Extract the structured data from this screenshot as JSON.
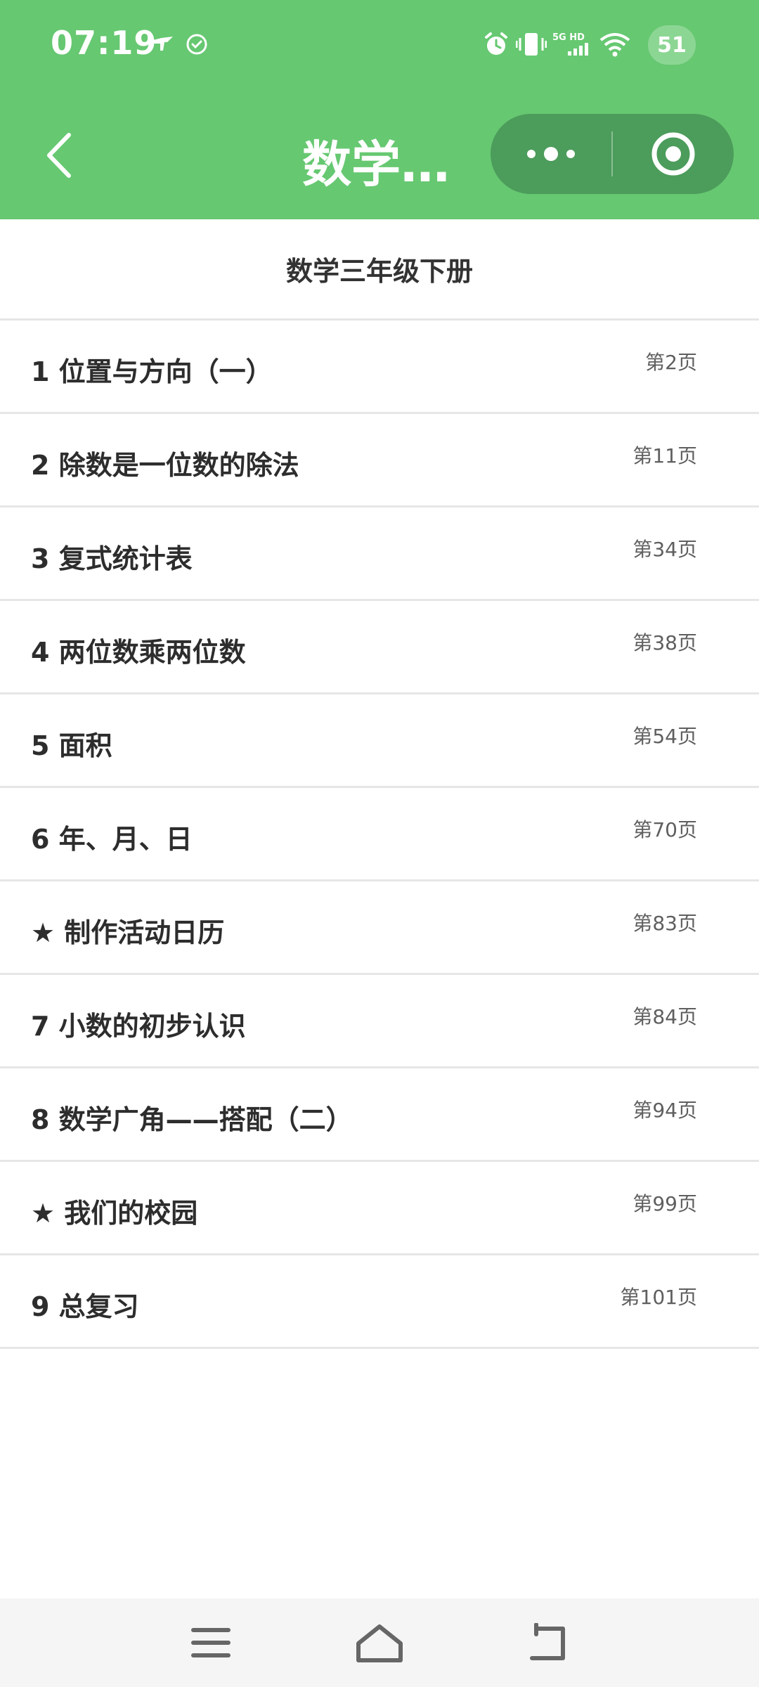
{
  "status_bar": {
    "time": "07:19",
    "network_label": "5G HD",
    "notification_badge": "51",
    "icons": [
      "bird-notification-icon",
      "check-circle-icon",
      "alarm-icon",
      "vibrate-icon",
      "signal-icon",
      "wifi-icon"
    ]
  },
  "navbar": {
    "title": "数学…",
    "back_icon": "chevron-left-icon",
    "more_icon": "more-dots-icon",
    "target_icon": "target-icon",
    "color": "#66c871",
    "capsule_color": "#4c9c5b"
  },
  "book": {
    "title": "数学三年级下册"
  },
  "chapters": [
    {
      "name": "1 位置与方向（一）",
      "page": "第2页"
    },
    {
      "name": "2 除数是一位数的除法",
      "page": "第11页"
    },
    {
      "name": "3 复式统计表",
      "page": "第34页"
    },
    {
      "name": "4 两位数乘两位数",
      "page": "第38页"
    },
    {
      "name": "5 面积",
      "page": "第54页"
    },
    {
      "name": "6 年、月、日",
      "page": "第70页"
    },
    {
      "name": "★ 制作活动日历",
      "page": "第83页"
    },
    {
      "name": "7 小数的初步认识",
      "page": "第84页"
    },
    {
      "name": "8 数学广角——搭配（二）",
      "page": "第94页"
    },
    {
      "name": "★ 我们的校园",
      "page": "第99页"
    },
    {
      "name": "9 总复习",
      "page": "第101页"
    }
  ],
  "system_nav": {
    "menu_icon": "menu-icon",
    "home_icon": "home-icon",
    "back_icon": "back-arrow-icon"
  }
}
